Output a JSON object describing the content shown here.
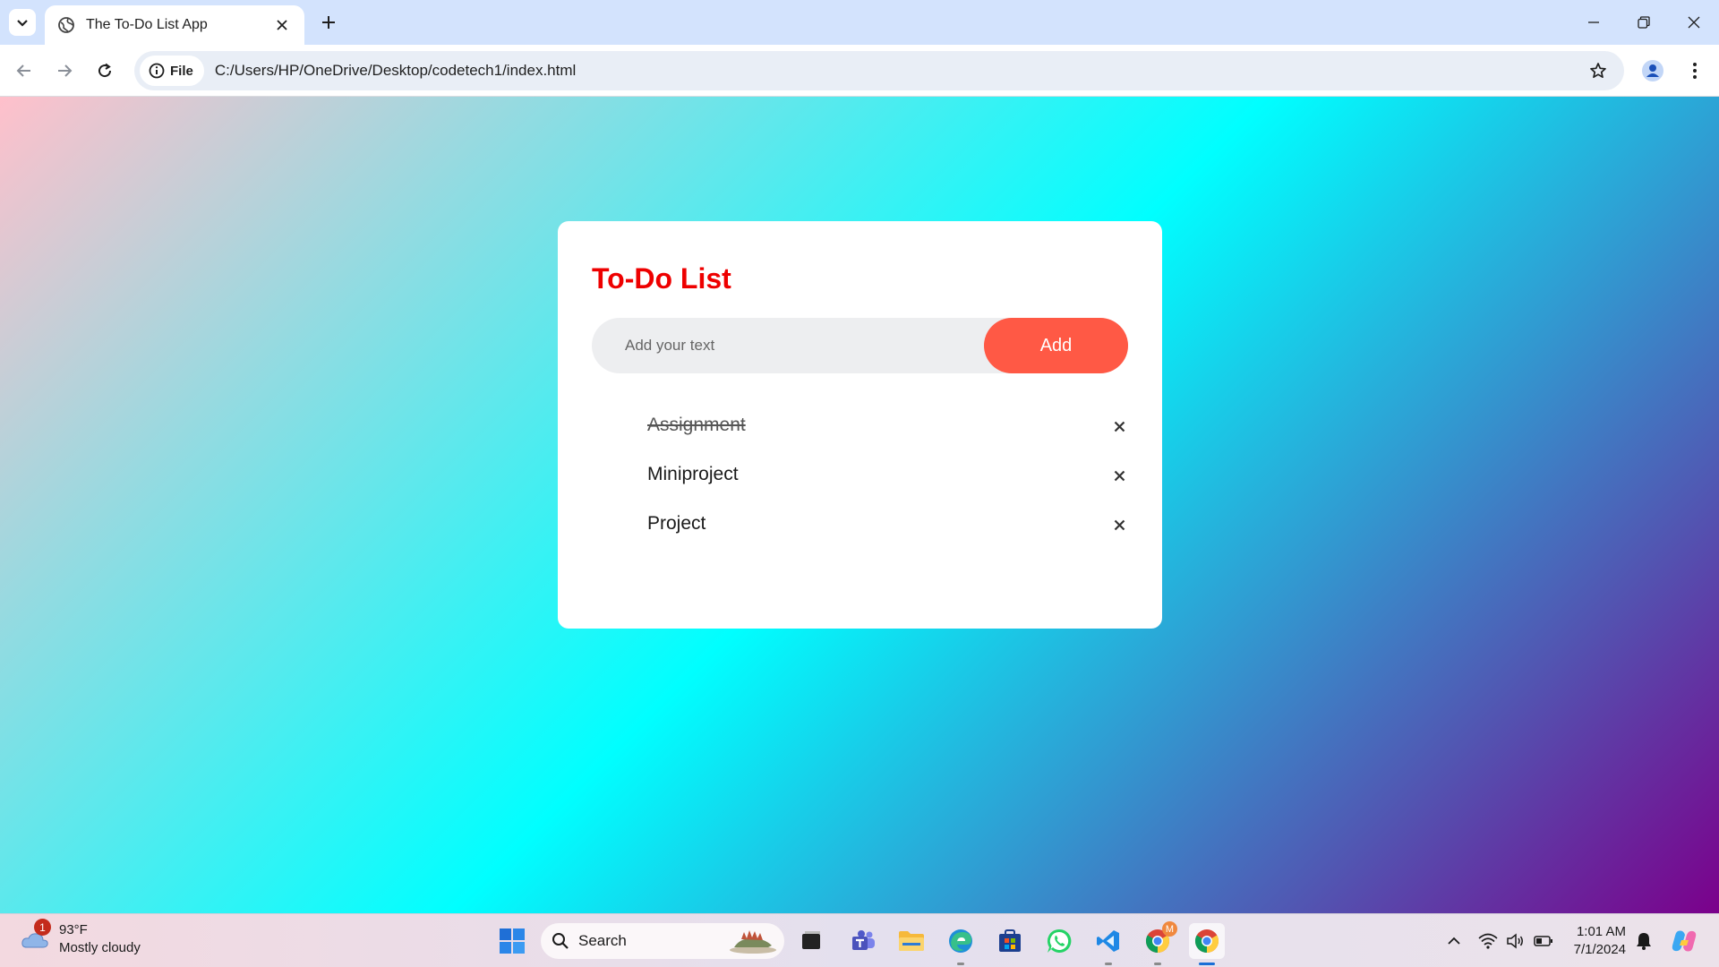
{
  "browser": {
    "tab_title": "The To-Do List App",
    "site_chip": "File",
    "url": "C:/Users/HP/OneDrive/Desktop/codetech1/index.html"
  },
  "app": {
    "title": "To-Do List",
    "input_placeholder": "Add your text",
    "add_label": "Add",
    "tasks": [
      {
        "text": "Assignment",
        "checked": true
      },
      {
        "text": "Miniproject",
        "checked": false
      },
      {
        "text": "Project",
        "checked": false
      }
    ],
    "remove_symbol": "×"
  },
  "taskbar": {
    "weather_badge": "1",
    "temperature": "93°F",
    "condition": "Mostly cloudy",
    "search_label": "Search",
    "badge_letter": "M",
    "time": "1:01 AM",
    "date": "7/1/2024"
  },
  "colors": {
    "title_red": "#ee0000",
    "add_button": "#ff5945",
    "gradient": [
      "#ffc0cb",
      "#00ffff",
      "#7b008b"
    ]
  }
}
